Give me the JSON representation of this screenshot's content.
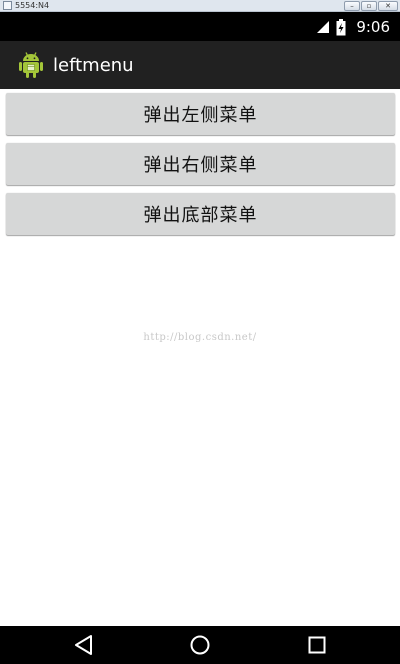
{
  "window": {
    "title": "5554:N4",
    "minimize_glyph": "–",
    "restore_glyph": "▫",
    "close_glyph": "✕"
  },
  "status_bar": {
    "time": "9:06",
    "icons": [
      "signal-icon",
      "battery-icon"
    ]
  },
  "action_bar": {
    "app_icon": "android-robot-icon",
    "title": "leftmenu"
  },
  "buttons": {
    "left_menu": "弹出左侧菜单",
    "right_menu": "弹出右侧菜单",
    "bottom_menu": "弹出底部菜单"
  },
  "watermark": "http://blog.csdn.net/",
  "nav_bar": {
    "icons": [
      "back-icon",
      "home-icon",
      "recents-icon"
    ]
  },
  "colors": {
    "status_bar": "#000000",
    "action_bar": "#212121",
    "button_bg": "#d6d7d7",
    "android_green": "#a4c639"
  }
}
